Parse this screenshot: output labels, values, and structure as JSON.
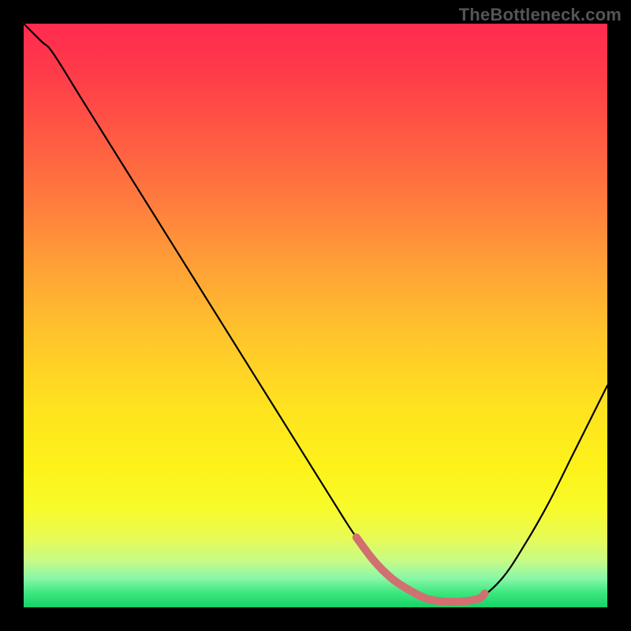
{
  "watermark": "TheBottleneck.com",
  "chart_data": {
    "type": "line",
    "title": "",
    "xlabel": "",
    "ylabel": "",
    "xlim": [
      0,
      100
    ],
    "ylim": [
      0,
      100
    ],
    "x": [
      0,
      3,
      5,
      10,
      15,
      20,
      25,
      30,
      35,
      40,
      45,
      50,
      55,
      57,
      60,
      63,
      66,
      69,
      72,
      75,
      78,
      82,
      86,
      90,
      94,
      97,
      100
    ],
    "values": [
      100,
      97,
      95,
      87,
      79,
      71,
      63,
      55,
      47,
      39,
      31,
      23,
      15,
      12,
      8,
      5,
      3,
      1.5,
      1,
      1,
      1.5,
      5,
      11,
      18,
      26,
      32,
      38
    ],
    "highlight_range": {
      "x_start": 57,
      "x_end": 79,
      "color": "#d07070"
    },
    "background_gradient": {
      "top": "#ff2b4f",
      "mid": "#ffd21f",
      "bottom": "#16d268"
    }
  }
}
